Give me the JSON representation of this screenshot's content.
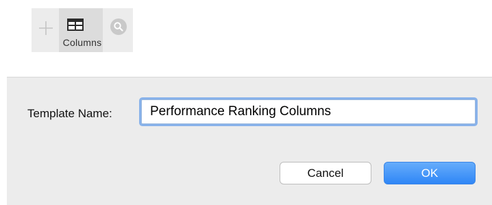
{
  "toolbar": {
    "icons": [
      "plus-icon",
      "columns-icon",
      "search-icon"
    ],
    "selected_label": "Columns"
  },
  "dialog": {
    "field_label": "Template Name:",
    "name_value": "Performance Ranking Columns",
    "cancel_label": "Cancel",
    "ok_label": "OK"
  },
  "colors": {
    "dialog_bg": "#ececec",
    "ok_button": "#3a8ef8",
    "focus_ring": "#88b2ea"
  }
}
